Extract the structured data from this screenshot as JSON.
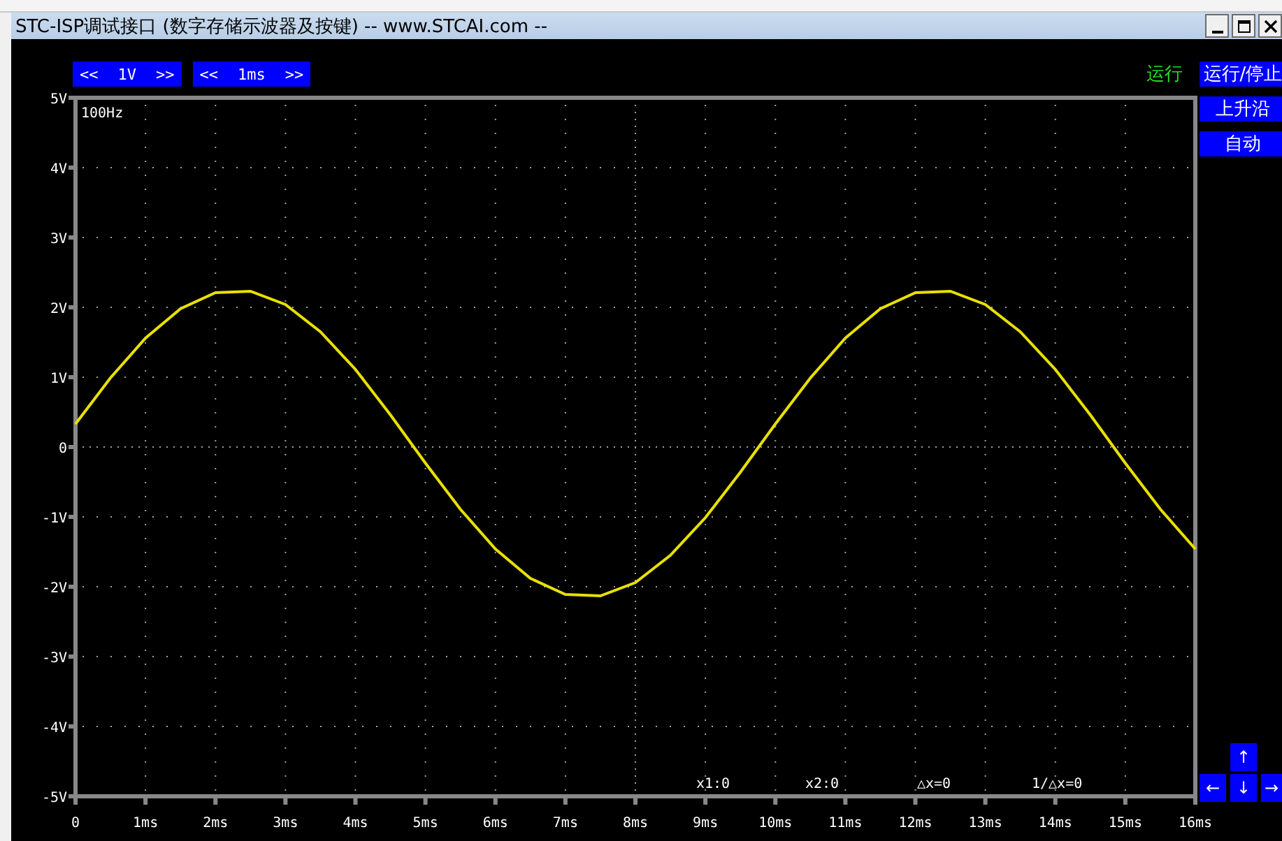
{
  "window": {
    "title": "STC-ISP调试接口 (数字存储示波器及按键) -- www.STCAI.com --"
  },
  "scale_controls": [
    {
      "decrease": "<<",
      "value": "1V",
      "increase": ">>"
    },
    {
      "decrease": "<<",
      "value": "1ms",
      "increase": ">>"
    }
  ],
  "run_status": "运行",
  "side_buttons": [
    "运行/停止",
    "上升沿",
    "自动"
  ],
  "arrow_pad": {
    "up": "↑",
    "left": "←",
    "down": "↓",
    "right": "→"
  },
  "plot": {
    "frequency": "100Hz",
    "readouts": [
      "x1:0",
      "x2:0",
      "△x=0",
      "1/△x=0"
    ],
    "chart_data": {
      "type": "line",
      "xlim": [
        0,
        16
      ],
      "ylim": [
        -5,
        5
      ],
      "xticks": [
        {
          "value": 0,
          "label": "0"
        },
        {
          "value": 1,
          "label": "1ms"
        },
        {
          "value": 2,
          "label": "2ms"
        },
        {
          "value": 3,
          "label": "3ms"
        },
        {
          "value": 4,
          "label": "4ms"
        },
        {
          "value": 5,
          "label": "5ms"
        },
        {
          "value": 6,
          "label": "6ms"
        },
        {
          "value": 7,
          "label": "7ms"
        },
        {
          "value": 8,
          "label": "8ms"
        },
        {
          "value": 9,
          "label": "9ms"
        },
        {
          "value": 10,
          "label": "10ms"
        },
        {
          "value": 11,
          "label": "11ms"
        },
        {
          "value": 12,
          "label": "12ms"
        },
        {
          "value": 13,
          "label": "13ms"
        },
        {
          "value": 14,
          "label": "14ms"
        },
        {
          "value": 15,
          "label": "15ms"
        },
        {
          "value": 16,
          "label": "16ms"
        }
      ],
      "yticks": [
        {
          "value": 5,
          "label": "5V"
        },
        {
          "value": 4,
          "label": "4V"
        },
        {
          "value": 3,
          "label": "3V"
        },
        {
          "value": 2,
          "label": "2V"
        },
        {
          "value": 1,
          "label": "1V"
        },
        {
          "value": 0,
          "label": "0"
        },
        {
          "value": -1,
          "label": "-1V"
        },
        {
          "value": -2,
          "label": "-2V"
        },
        {
          "value": -3,
          "label": "-3V"
        },
        {
          "value": -4,
          "label": "-4V"
        },
        {
          "value": -5,
          "label": "-5V"
        }
      ],
      "x": [
        0,
        0.5,
        1,
        1.5,
        2,
        2.5,
        3,
        3.5,
        4,
        4.5,
        5,
        5.5,
        6,
        6.5,
        7,
        7.5,
        8,
        8.5,
        9,
        9.5,
        10,
        10.5,
        11,
        11.5,
        12,
        12.5,
        13,
        13.5,
        14,
        14.5,
        15,
        15.5,
        16
      ],
      "grid": true,
      "series": [
        {
          "color": "#e8e000",
          "values": [
            0.33,
            0.99,
            1.56,
            1.98,
            2.21,
            2.23,
            2.04,
            1.65,
            1.11,
            0.46,
            -0.23,
            -0.89,
            -1.46,
            -1.88,
            -2.11,
            -2.13,
            -1.94,
            -1.55,
            -1.01,
            -0.36,
            0.33,
            0.99,
            1.56,
            1.98,
            2.21,
            2.23,
            2.04,
            1.65,
            1.11,
            0.46,
            -0.23,
            -0.89,
            -1.46
          ]
        }
      ]
    }
  }
}
